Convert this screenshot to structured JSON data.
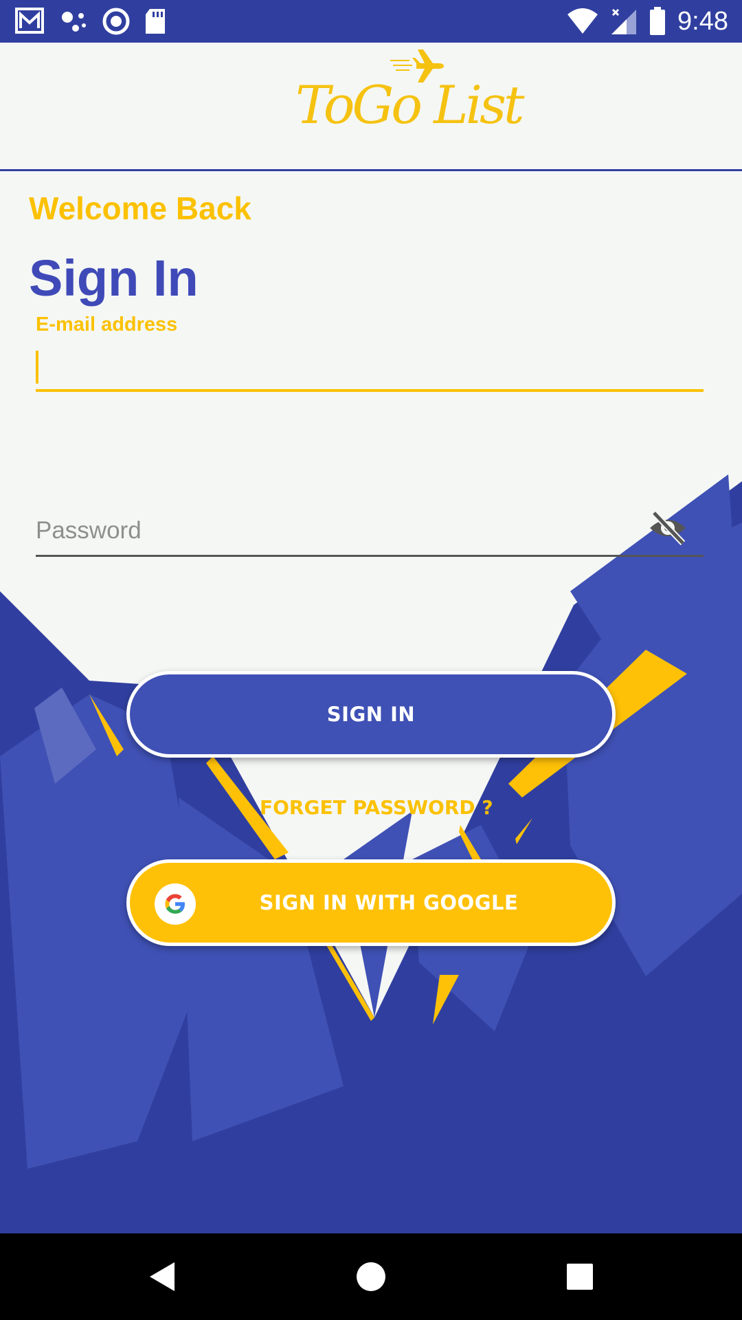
{
  "status_bar": {
    "time": "9:48",
    "icons": [
      "gmail-icon",
      "dots-icon",
      "circle-icon",
      "sd-card-icon",
      "wifi-icon",
      "signal-icon",
      "battery-icon"
    ]
  },
  "header": {
    "logo_text": "ToGo List",
    "logo_icon": "airplane-icon"
  },
  "form": {
    "welcome": "Welcome Back",
    "title": "Sign In",
    "email_label": "E-mail address",
    "email_value": "",
    "password_placeholder": "Password",
    "password_value": ""
  },
  "buttons": {
    "sign_in": "SIGN IN",
    "forget_password": "FORGET PASSWORD ?",
    "google": "SIGN IN WITH GOOGLE"
  },
  "nav": {
    "back": "back-icon",
    "home": "home-icon",
    "recents": "recents-icon"
  },
  "colors": {
    "primary": "#303f9f",
    "button_blue": "#3f51b5",
    "accent": "#ffc107",
    "background": "#f5f7f5"
  }
}
